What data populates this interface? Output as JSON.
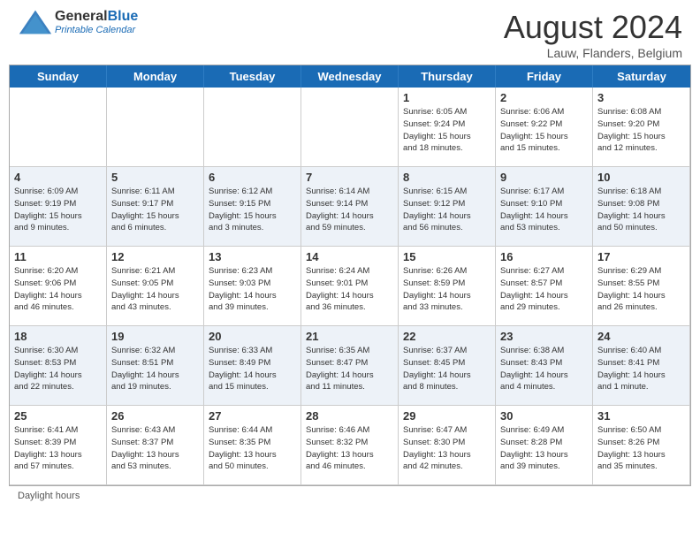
{
  "header": {
    "logo_general": "General",
    "logo_blue": "Blue",
    "month_year": "August 2024",
    "location": "Lauw, Flanders, Belgium"
  },
  "weekdays": [
    "Sunday",
    "Monday",
    "Tuesday",
    "Wednesday",
    "Thursday",
    "Friday",
    "Saturday"
  ],
  "footer": {
    "daylight_label": "Daylight hours"
  },
  "weeks": [
    [
      {
        "day": "",
        "info": ""
      },
      {
        "day": "",
        "info": ""
      },
      {
        "day": "",
        "info": ""
      },
      {
        "day": "",
        "info": ""
      },
      {
        "day": "1",
        "info": "Sunrise: 6:05 AM\nSunset: 9:24 PM\nDaylight: 15 hours\nand 18 minutes."
      },
      {
        "day": "2",
        "info": "Sunrise: 6:06 AM\nSunset: 9:22 PM\nDaylight: 15 hours\nand 15 minutes."
      },
      {
        "day": "3",
        "info": "Sunrise: 6:08 AM\nSunset: 9:20 PM\nDaylight: 15 hours\nand 12 minutes."
      }
    ],
    [
      {
        "day": "4",
        "info": "Sunrise: 6:09 AM\nSunset: 9:19 PM\nDaylight: 15 hours\nand 9 minutes."
      },
      {
        "day": "5",
        "info": "Sunrise: 6:11 AM\nSunset: 9:17 PM\nDaylight: 15 hours\nand 6 minutes."
      },
      {
        "day": "6",
        "info": "Sunrise: 6:12 AM\nSunset: 9:15 PM\nDaylight: 15 hours\nand 3 minutes."
      },
      {
        "day": "7",
        "info": "Sunrise: 6:14 AM\nSunset: 9:14 PM\nDaylight: 14 hours\nand 59 minutes."
      },
      {
        "day": "8",
        "info": "Sunrise: 6:15 AM\nSunset: 9:12 PM\nDaylight: 14 hours\nand 56 minutes."
      },
      {
        "day": "9",
        "info": "Sunrise: 6:17 AM\nSunset: 9:10 PM\nDaylight: 14 hours\nand 53 minutes."
      },
      {
        "day": "10",
        "info": "Sunrise: 6:18 AM\nSunset: 9:08 PM\nDaylight: 14 hours\nand 50 minutes."
      }
    ],
    [
      {
        "day": "11",
        "info": "Sunrise: 6:20 AM\nSunset: 9:06 PM\nDaylight: 14 hours\nand 46 minutes."
      },
      {
        "day": "12",
        "info": "Sunrise: 6:21 AM\nSunset: 9:05 PM\nDaylight: 14 hours\nand 43 minutes."
      },
      {
        "day": "13",
        "info": "Sunrise: 6:23 AM\nSunset: 9:03 PM\nDaylight: 14 hours\nand 39 minutes."
      },
      {
        "day": "14",
        "info": "Sunrise: 6:24 AM\nSunset: 9:01 PM\nDaylight: 14 hours\nand 36 minutes."
      },
      {
        "day": "15",
        "info": "Sunrise: 6:26 AM\nSunset: 8:59 PM\nDaylight: 14 hours\nand 33 minutes."
      },
      {
        "day": "16",
        "info": "Sunrise: 6:27 AM\nSunset: 8:57 PM\nDaylight: 14 hours\nand 29 minutes."
      },
      {
        "day": "17",
        "info": "Sunrise: 6:29 AM\nSunset: 8:55 PM\nDaylight: 14 hours\nand 26 minutes."
      }
    ],
    [
      {
        "day": "18",
        "info": "Sunrise: 6:30 AM\nSunset: 8:53 PM\nDaylight: 14 hours\nand 22 minutes."
      },
      {
        "day": "19",
        "info": "Sunrise: 6:32 AM\nSunset: 8:51 PM\nDaylight: 14 hours\nand 19 minutes."
      },
      {
        "day": "20",
        "info": "Sunrise: 6:33 AM\nSunset: 8:49 PM\nDaylight: 14 hours\nand 15 minutes."
      },
      {
        "day": "21",
        "info": "Sunrise: 6:35 AM\nSunset: 8:47 PM\nDaylight: 14 hours\nand 11 minutes."
      },
      {
        "day": "22",
        "info": "Sunrise: 6:37 AM\nSunset: 8:45 PM\nDaylight: 14 hours\nand 8 minutes."
      },
      {
        "day": "23",
        "info": "Sunrise: 6:38 AM\nSunset: 8:43 PM\nDaylight: 14 hours\nand 4 minutes."
      },
      {
        "day": "24",
        "info": "Sunrise: 6:40 AM\nSunset: 8:41 PM\nDaylight: 14 hours\nand 1 minute."
      }
    ],
    [
      {
        "day": "25",
        "info": "Sunrise: 6:41 AM\nSunset: 8:39 PM\nDaylight: 13 hours\nand 57 minutes."
      },
      {
        "day": "26",
        "info": "Sunrise: 6:43 AM\nSunset: 8:37 PM\nDaylight: 13 hours\nand 53 minutes."
      },
      {
        "day": "27",
        "info": "Sunrise: 6:44 AM\nSunset: 8:35 PM\nDaylight: 13 hours\nand 50 minutes."
      },
      {
        "day": "28",
        "info": "Sunrise: 6:46 AM\nSunset: 8:32 PM\nDaylight: 13 hours\nand 46 minutes."
      },
      {
        "day": "29",
        "info": "Sunrise: 6:47 AM\nSunset: 8:30 PM\nDaylight: 13 hours\nand 42 minutes."
      },
      {
        "day": "30",
        "info": "Sunrise: 6:49 AM\nSunset: 8:28 PM\nDaylight: 13 hours\nand 39 minutes."
      },
      {
        "day": "31",
        "info": "Sunrise: 6:50 AM\nSunset: 8:26 PM\nDaylight: 13 hours\nand 35 minutes."
      }
    ]
  ]
}
